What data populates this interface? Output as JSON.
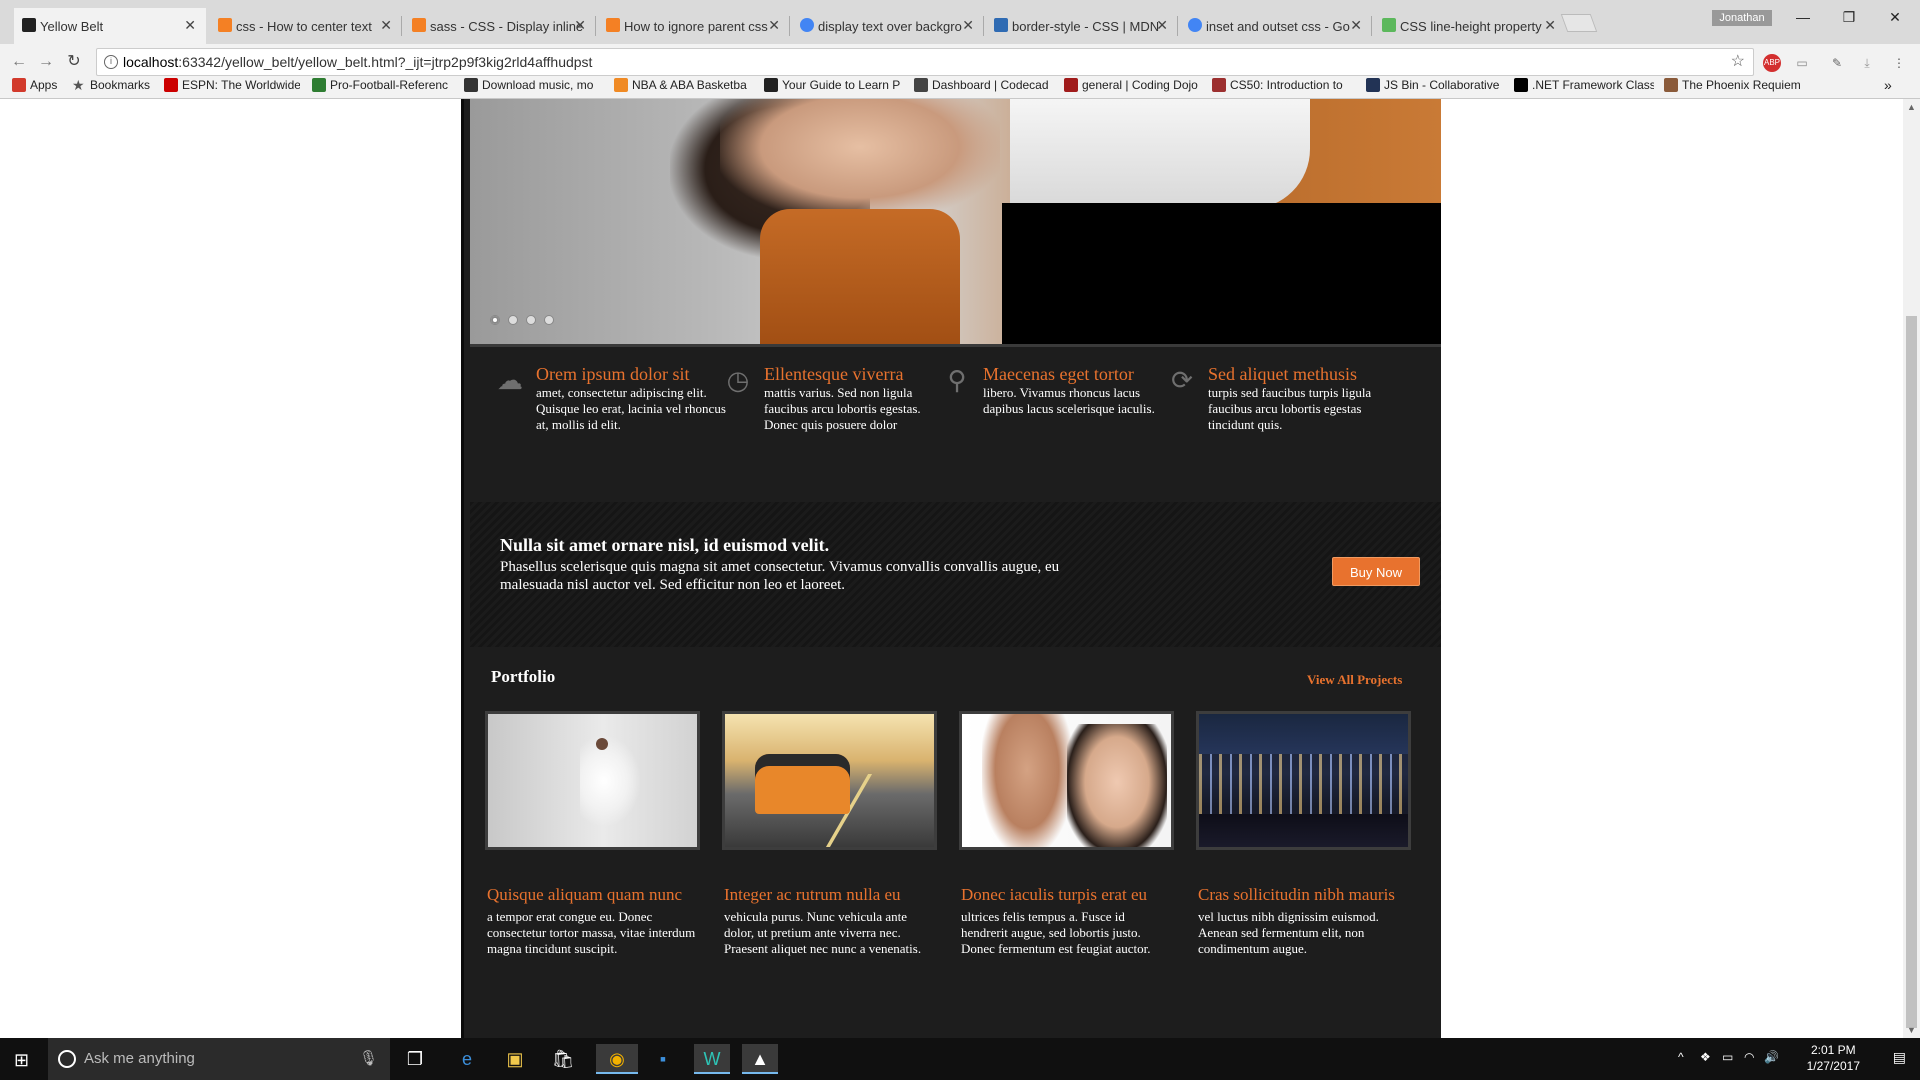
{
  "browser": {
    "tabs": [
      {
        "title": "Yellow Belt",
        "active": true,
        "favicon_color": "#222222"
      },
      {
        "title": "css - How to center text",
        "favicon_color": "#f48024"
      },
      {
        "title": "sass - CSS - Display inline",
        "favicon_color": "#f48024"
      },
      {
        "title": "How to ignore parent css",
        "favicon_color": "#f48024"
      },
      {
        "title": "display text over backgro",
        "favicon_color": "#4285f4"
      },
      {
        "title": "border-style - CSS | MDN",
        "favicon_color": "#2f6bb3"
      },
      {
        "title": "inset and outset css - Go",
        "favicon_color": "#4285f4"
      },
      {
        "title": "CSS line-height property",
        "favicon_color": "#5cb85c"
      }
    ],
    "user_badge": "Jonathan",
    "address": {
      "host": "localhost",
      "rest": ":63342/yellow_belt/yellow_belt.html?_ijt=jtrp2p9f3kig2rld4affhudpst"
    },
    "bookmarks": [
      {
        "label": "Apps",
        "color": "#d23a2c"
      },
      {
        "label": "Bookmarks",
        "color": "#555555"
      },
      {
        "label": "ESPN: The Worldwide",
        "color": "#cc0000"
      },
      {
        "label": "Pro-Football-Referenc",
        "color": "#2e7d32"
      },
      {
        "label": "Download music, mo",
        "color": "#333333"
      },
      {
        "label": "NBA & ABA Basketba",
        "color": "#f08a24"
      },
      {
        "label": "Your Guide to Learn P",
        "color": "#222222"
      },
      {
        "label": "Dashboard | Codecad",
        "color": "#444444"
      },
      {
        "label": "general | Coding Dojo",
        "color": "#a01b1b"
      },
      {
        "label": "CS50: Introduction to",
        "color": "#9c2f2f"
      },
      {
        "label": "JS Bin - Collaborative",
        "color": "#223355"
      },
      {
        "label": ".NET Framework Class",
        "color": "#000000"
      },
      {
        "label": "The Phoenix Requiem",
        "color": "#8a5a3a"
      }
    ]
  },
  "site": {
    "features": [
      {
        "icon": "cloud-icon",
        "glyph": "☁",
        "title": "Orem ipsum dolor sit",
        "text": "amet, consectetur adipiscing elit. Quisque leo erat, lacinia vel rhoncus at, mollis id elit."
      },
      {
        "icon": "clock-icon",
        "glyph": "◷",
        "title": "Ellentesque viverra",
        "text": "mattis varius. Sed non ligula faucibus arcu lobortis egestas. Donec quis posuere dolor"
      },
      {
        "icon": "map-pin-icon",
        "glyph": "⚲",
        "title": "Maecenas eget tortor",
        "text": "libero. Vivamus rhoncus lacus dapibus lacus scelerisque iaculis."
      },
      {
        "icon": "refresh-icon",
        "glyph": "⟳",
        "title": "Sed aliquet methusis",
        "text": "turpis sed faucibus turpis ligula faucibus arcu lobortis egestas tincidunt quis."
      }
    ],
    "promo": {
      "heading": "Nulla sit amet ornare nisl, id euismod velit.",
      "text": "Phasellus scelerisque quis magna sit amet consectetur. Vivamus convallis convallis augue, eu malesuada nisl auctor vel. Sed efficitur non leo et laoreet.",
      "button": "Buy Now"
    },
    "portfolio": {
      "title": "Portfolio",
      "view_all": "View All Projects",
      "items": [
        {
          "title": "Quisque aliquam quam nunc",
          "text": "a tempor erat congue eu. Donec consectetur tortor massa, vitae interdum magna tincidunt suscipit."
        },
        {
          "title": "Integer ac rutrum nulla eu",
          "text": "vehicula purus. Nunc vehicula ante dolor, ut pretium ante viverra nec. Praesent aliquet nec nunc a venenatis."
        },
        {
          "title": "Donec iaculis turpis erat eu",
          "text": "ultrices felis tempus a. Fusce id hendrerit augue, sed lobortis justo. Donec fermentum est feugiat auctor."
        },
        {
          "title": "Cras sollicitudin nibh mauris",
          "text": "vel luctus nibh dignissim euismod. Aenean sed fermentum elit, non condimentum augue."
        }
      ]
    },
    "accent": "#e8722e"
  },
  "taskbar": {
    "search_placeholder": "Ask me anything",
    "time": "2:01 PM",
    "date": "1/27/2017"
  }
}
